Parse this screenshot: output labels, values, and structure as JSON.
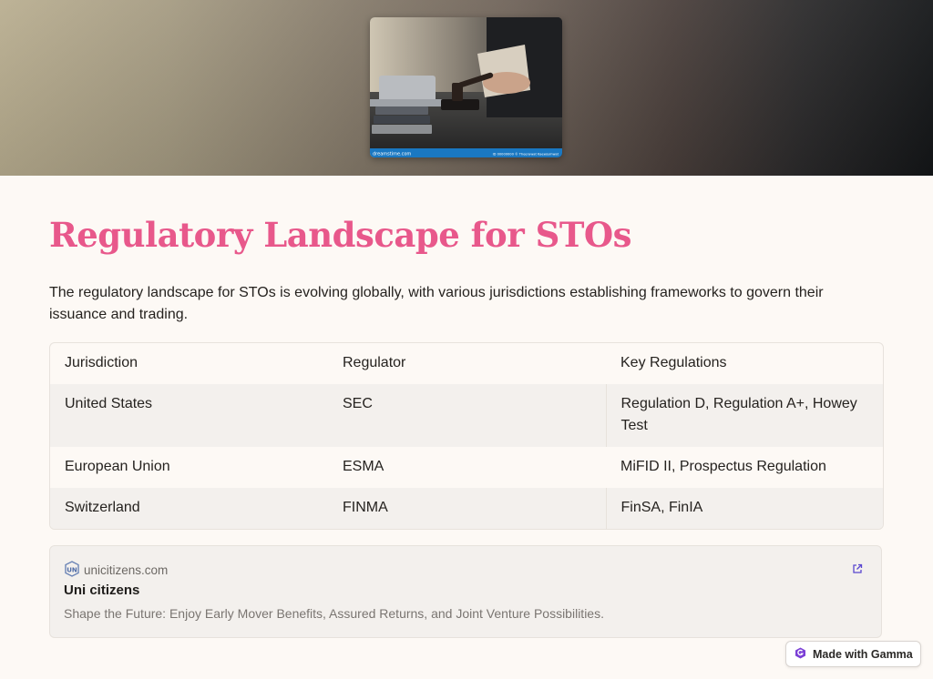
{
  "hero": {
    "image_footer_left": "dreamstime.com",
    "image_footer_right": "ID 00000000 © Theerawat Kaewjumwat"
  },
  "page": {
    "title": "Regulatory Landscape for STOs",
    "intro": "The regulatory landscape for STOs is evolving globally, with various jurisdictions establishing frameworks to govern their issuance and trading."
  },
  "table": {
    "headers": [
      "Jurisdiction",
      "Regulator",
      "Key Regulations"
    ],
    "rows": [
      [
        "United States",
        "SEC",
        "Regulation D, Regulation A+, Howey Test"
      ],
      [
        "European Union",
        "ESMA",
        "MiFID II, Prospectus Regulation"
      ],
      [
        "Switzerland",
        "FINMA",
        "FinSA, FinIA"
      ]
    ]
  },
  "link_card": {
    "site": "unicitizens.com",
    "site_icon": "unicitizens-logo-icon",
    "title": "Uni citizens",
    "description": "Shape the Future: Enjoy Early Mover Benefits, Assured Returns, and Joint Venture Possibilities.",
    "action_icon": "external-link-icon"
  },
  "badge": {
    "label": "Made with Gamma",
    "icon": "gamma-logo-icon"
  },
  "colors": {
    "title": "#e8588b",
    "background": "#fdf9f5",
    "shaded_row": "#f3f0ed",
    "footer_bar": "#1a78c2"
  }
}
